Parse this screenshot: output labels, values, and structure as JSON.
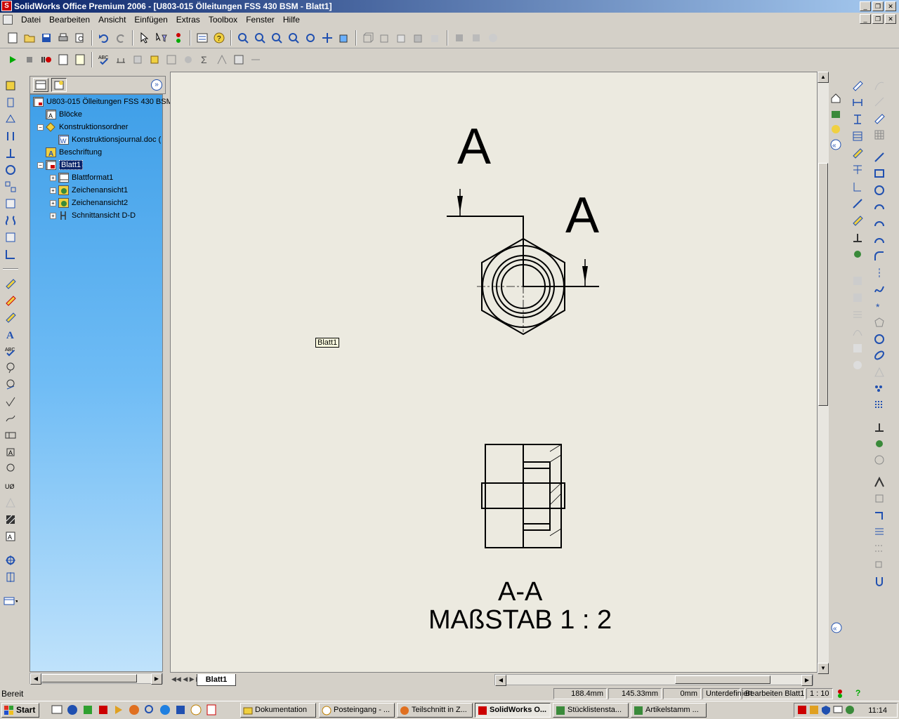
{
  "window": {
    "title": "SolidWorks Office Premium 2006 - [U803-015 Ölleitungen FSS 430 BSM - Blatt1]",
    "app_icon": "solidworks-icon"
  },
  "menu": [
    "Datei",
    "Bearbeiten",
    "Ansicht",
    "Einfügen",
    "Extras",
    "Toolbox",
    "Fenster",
    "Hilfe"
  ],
  "tree": {
    "root": "U803-015 Ölleitungen FSS 430 BSM",
    "items": [
      {
        "label": "Blöcke",
        "icon": "blocks-icon"
      },
      {
        "label": "Konstruktionsordner",
        "icon": "folder-icon"
      },
      {
        "label": "Konstruktionsjournal.doc (",
        "icon": "word-doc-icon"
      },
      {
        "label": "Beschriftung",
        "icon": "annotation-icon"
      },
      {
        "label": "Blatt1",
        "icon": "sheet-icon"
      },
      {
        "label": "Blattformat1",
        "icon": "sheet-format-icon"
      },
      {
        "label": "Zeichenansicht1",
        "icon": "drawing-view-icon"
      },
      {
        "label": "Zeichenansicht2",
        "icon": "drawing-view-icon"
      },
      {
        "label": "Schnittansicht D-D",
        "icon": "section-view-icon"
      }
    ]
  },
  "drawing": {
    "label_a_top": "A",
    "label_a_right": "A",
    "tooltip": "Blatt1",
    "section_label": "A-A",
    "scale_label": "MAßSTAB 1 : 2"
  },
  "sheet_tab": "Blatt1",
  "status": {
    "text": "Bereit",
    "x": "188.4mm",
    "y": "145.33mm",
    "z": "0mm",
    "state": "Unterdefiniert",
    "mode": "Bearbeiten Blatt1",
    "scale": "1 : 10",
    "help": "?"
  },
  "taskbar": {
    "start": "Start",
    "time": "11:14",
    "buttons": [
      "Dokumentation",
      "Posteingang - ...",
      "Teilschnitt in Z...",
      "SolidWorks O...",
      "Stücklistensta...",
      "Artikelstamm ..."
    ]
  }
}
